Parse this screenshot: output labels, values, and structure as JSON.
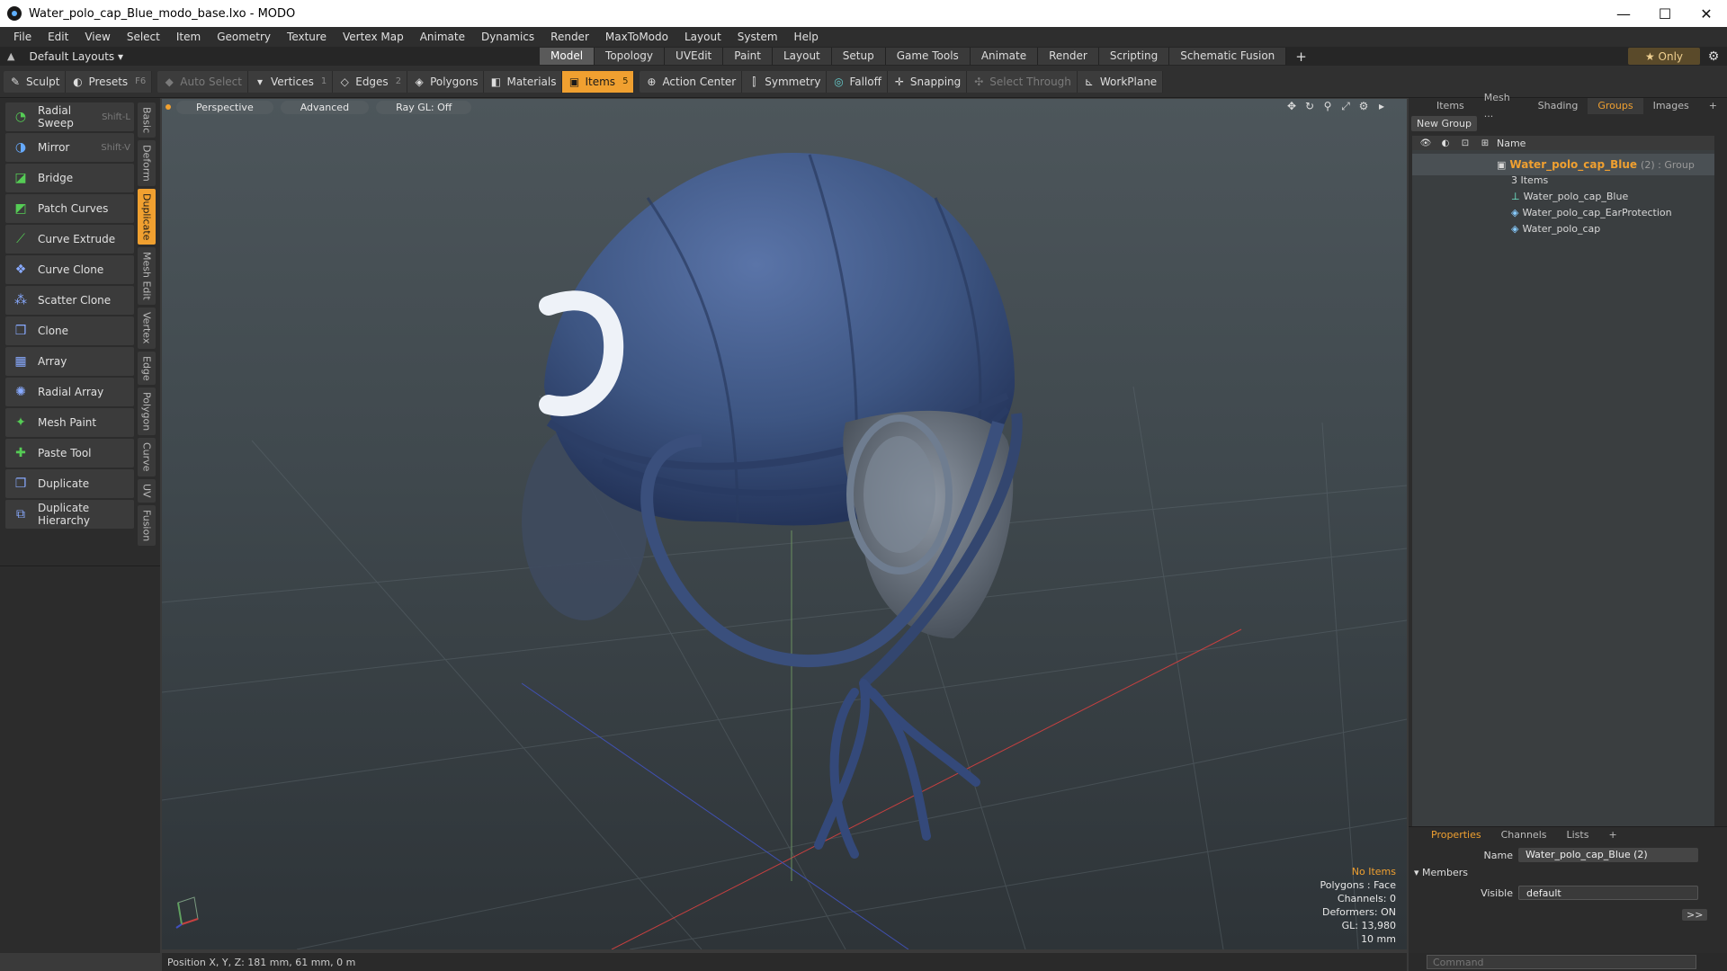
{
  "window": {
    "title": "Water_polo_cap_Blue_modo_base.lxo - MODO",
    "minimize": "—",
    "maximize": "☐",
    "close": "✕"
  },
  "menu": [
    "File",
    "Edit",
    "View",
    "Select",
    "Item",
    "Geometry",
    "Texture",
    "Vertex Map",
    "Animate",
    "Dynamics",
    "Render",
    "MaxToModo",
    "Layout",
    "System",
    "Help"
  ],
  "layout": {
    "dropdown": "Default Layouts ▾",
    "tabs": [
      "Model",
      "Topology",
      "UVEdit",
      "Paint",
      "Layout",
      "Setup",
      "Game Tools",
      "Animate",
      "Render",
      "Scripting",
      "Schematic Fusion"
    ],
    "active_tab": "Model",
    "add": "+",
    "only": "★ Only"
  },
  "toolbar": {
    "sculpt": "Sculpt",
    "presets": "Presets",
    "presets_key": "F6",
    "auto_select": "Auto Select",
    "vertices": "Vertices",
    "vertices_key": "1",
    "edges": "Edges",
    "edges_key": "2",
    "polygons": "Polygons",
    "materials": "Materials",
    "items": "Items",
    "items_key": "5",
    "action_center": "Action Center",
    "symmetry": "Symmetry",
    "falloff": "Falloff",
    "snapping": "Snapping",
    "select_through": "Select Through",
    "workplane": "WorkPlane"
  },
  "tools": [
    {
      "label": "Radial Sweep",
      "key": "Shift-L"
    },
    {
      "label": "Mirror",
      "key": "Shift-V"
    },
    {
      "label": "Bridge",
      "key": ""
    },
    {
      "label": "Patch Curves",
      "key": ""
    },
    {
      "label": "Curve Extrude",
      "key": ""
    },
    {
      "label": "Curve Clone",
      "key": ""
    },
    {
      "label": "Scatter Clone",
      "key": ""
    },
    {
      "label": "Clone",
      "key": ""
    },
    {
      "label": "Array",
      "key": ""
    },
    {
      "label": "Radial Array",
      "key": ""
    },
    {
      "label": "Mesh Paint",
      "key": ""
    },
    {
      "label": "Paste Tool",
      "key": ""
    },
    {
      "label": "Duplicate",
      "key": ""
    },
    {
      "label": "Duplicate Hierarchy",
      "key": ""
    }
  ],
  "vtabs": [
    "Basic",
    "Deform",
    "Duplicate",
    "Mesh Edit",
    "Vertex",
    "Edge",
    "Polygon",
    "Curve",
    "UV",
    "Fusion"
  ],
  "vtab_active": "Duplicate",
  "viewport": {
    "view": "Perspective",
    "shading": "Advanced",
    "raygl": "Ray GL: Off",
    "info": {
      "items": "No Items",
      "polygons": "Polygons : Face",
      "channels": "Channels: 0",
      "deformers": "Deformers: ON",
      "gl": "GL: 13,980",
      "scale": "10 mm"
    }
  },
  "right_panel": {
    "tabs": [
      "Items",
      "Mesh ...",
      "Shading",
      "Groups",
      "Images",
      "+"
    ],
    "active_tab": "Groups",
    "new_group": "New Group",
    "name_header": "Name",
    "group": {
      "name": "Water_polo_cap_Blue",
      "suffix": "(2) : Group",
      "count": "3 Items"
    },
    "items": [
      "Water_polo_cap_Blue",
      "Water_polo_cap_EarProtection",
      "Water_polo_cap"
    ],
    "prop_tabs": [
      "Properties",
      "Channels",
      "Lists",
      "+"
    ],
    "prop_active": "Properties",
    "name_label": "Name",
    "name_value": "Water_polo_cap_Blue (2)",
    "members_label": "Members",
    "visible_label": "Visible",
    "visible_value": "default",
    "more": ">>"
  },
  "status": {
    "position": "Position X, Y, Z:   181 mm, 61 mm, 0 m"
  },
  "command": {
    "placeholder": "Command"
  },
  "colors": {
    "accent": "#f0a030",
    "cap_blue": "#3d5582"
  }
}
